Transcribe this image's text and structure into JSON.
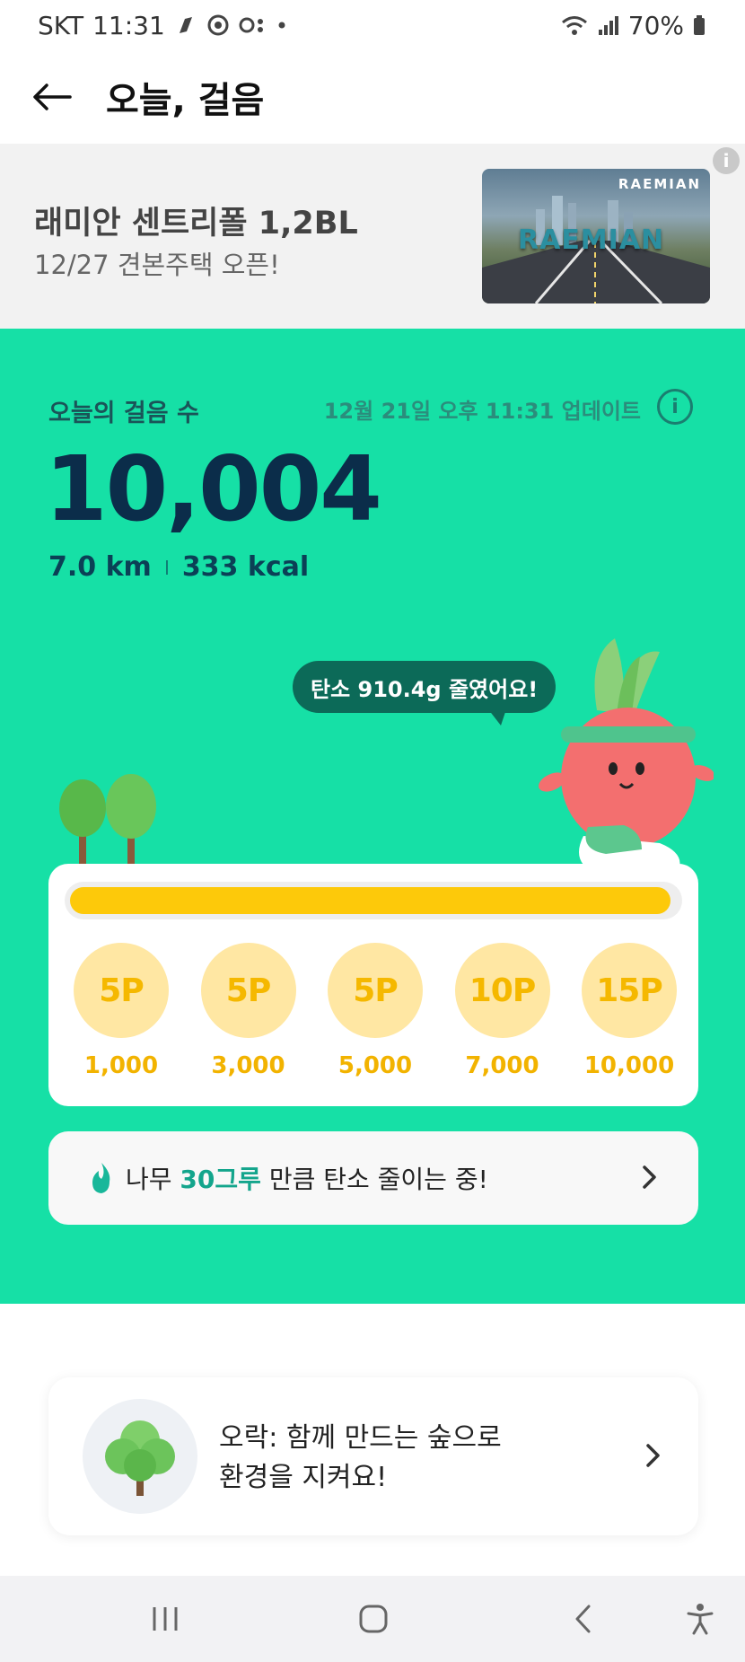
{
  "status_bar": {
    "carrier": "SKT",
    "time": "11:31",
    "battery": "70%"
  },
  "header": {
    "title": "오늘, 걸음"
  },
  "ad": {
    "title": "래미안 센트리폴 1,2BL",
    "subtitle": "12/27 견본주택 오픈!",
    "brand": "RAEMIAN",
    "overlay_word": "RAEMIAN",
    "info_icon": "i"
  },
  "steps": {
    "label": "오늘의 걸음 수",
    "updated": "12월 21일 오후 11:31 업데이트",
    "count": "10,004",
    "distance": "7.0 km",
    "calories": "333 kcal",
    "info_icon": "i"
  },
  "carbon_bubble": "탄소 910.4g 줄였어요!",
  "progress": {
    "fill_fraction": 0.99,
    "milestones": [
      {
        "points": "5P",
        "steps": "1,000"
      },
      {
        "points": "5P",
        "steps": "3,000"
      },
      {
        "points": "5P",
        "steps": "5,000"
      },
      {
        "points": "10P",
        "steps": "7,000"
      },
      {
        "points": "15P",
        "steps": "10,000"
      }
    ]
  },
  "carbon_card": {
    "prefix": "나무 ",
    "highlight": "30그루",
    "suffix": " 만큼 탄소 줄이는 중!"
  },
  "forest_card": {
    "line1": "오락: 함께 만드는 숲으로",
    "line2": "환경을 지켜요!"
  },
  "colors": {
    "green": "#16e0a6",
    "navy": "#0b2d4a",
    "gold": "#fdc90a",
    "coin": "#ffe7a3"
  }
}
